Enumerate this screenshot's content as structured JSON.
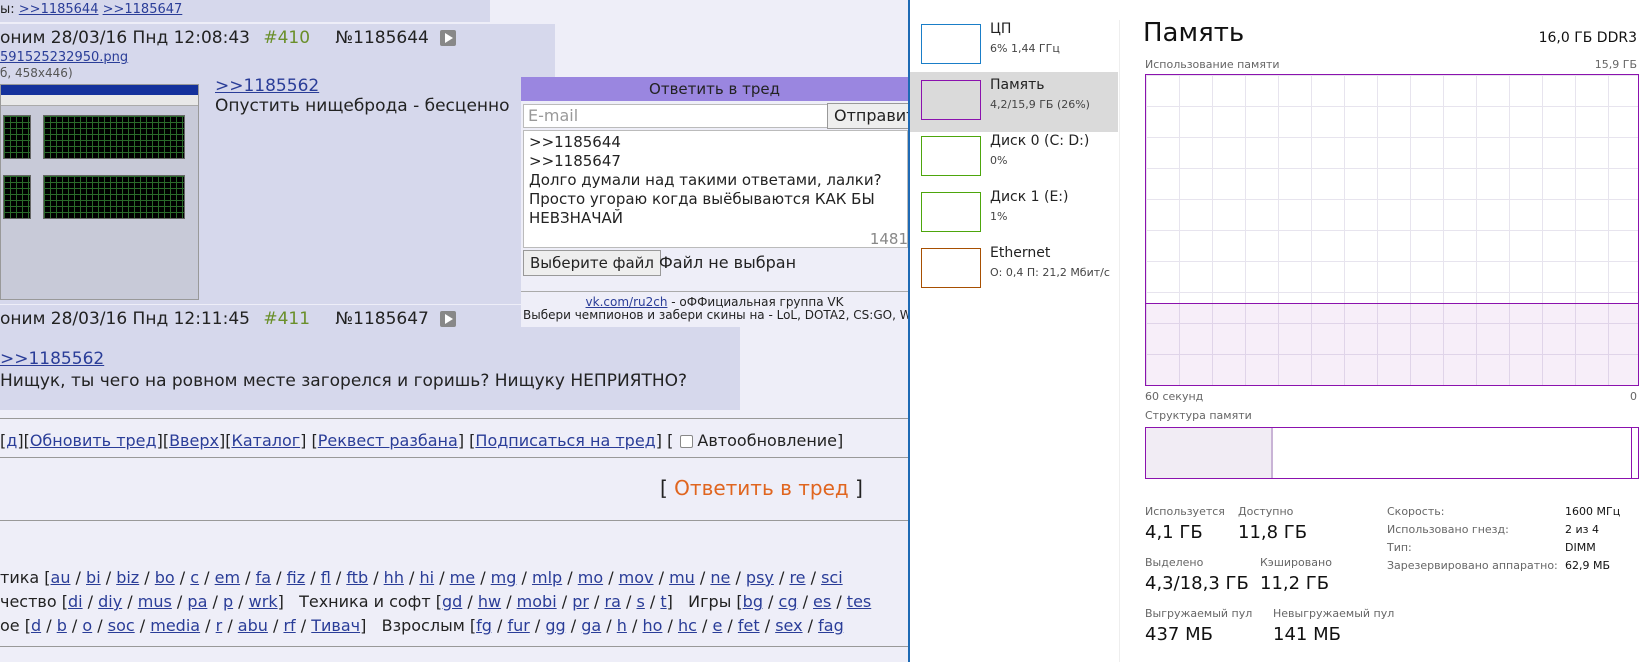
{
  "forum": {
    "topbar": {
      "prefix": "ы: ",
      "links": [
        ">>1185644",
        ">>1185647"
      ]
    },
    "post410": {
      "author_date": "оним 28/03/16 Пнд 12:08:43",
      "num": "#410",
      "id": "№1185644",
      "file": "591525232950.png",
      "file_meta": "б, 458x446)",
      "reply_link": ">>1185562",
      "text": "Опустить нищеброда - бесценно"
    },
    "post411": {
      "author_date": "оним 28/03/16 Пнд 12:11:45",
      "num": "#411",
      "id": "№1185647",
      "reply_link": ">>1185562",
      "text": "Нищук, ты чего на ровном месте загорелся и горишь? Нищуку НЕПРИЯТНО?"
    },
    "reply_form": {
      "title": "Ответить в тред",
      "email_placeholder": "E-mail",
      "send_label": "Отправит",
      "message_lines": [
        ">>1185644",
        ">>1185647",
        "Долго думали над такими ответами, лалки?",
        "Просто угораю когда выёбываются КАК БЫ",
        "НЕВЗНАЧАЙ"
      ],
      "char_count": "1481",
      "choose_file": "Выберите файл",
      "file_status": "Файл не выбран",
      "vk_link": "vk.com/ru2ch",
      "vk_text": " - оФФициальная группа VK",
      "promo": "Выбери чемпионов и забери скины на - LoL, DOTA2, CS:GO, W"
    },
    "nav": {
      "items": [
        "д",
        "Обновить тред",
        "Вверх",
        "Каталог",
        "Реквест разбана",
        "Подписаться на тред"
      ],
      "autoupdate_label": "Автообновление"
    },
    "reply_thread": "Ответить в тред",
    "boards": {
      "row1_label": "тика",
      "row1": [
        "au",
        "bi",
        "biz",
        "bo",
        "c",
        "em",
        "fa",
        "fiz",
        "fl",
        "ftb",
        "hh",
        "hi",
        "me",
        "mg",
        "mlp",
        "mo",
        "mov",
        "mu",
        "ne",
        "psy",
        "re",
        "sci"
      ],
      "row2a_label": "чество",
      "row2a": [
        "di",
        "diy",
        "mus",
        "pa",
        "p",
        "wrk"
      ],
      "row2b_label": "Техника и софт",
      "row2b": [
        "gd",
        "hw",
        "mobi",
        "pr",
        "ra",
        "s",
        "t"
      ],
      "row2c_label": "Игры",
      "row2c": [
        "bg",
        "cg",
        "es",
        "tes"
      ],
      "row3a_label": "ое",
      "row3a": [
        "d",
        "b",
        "o",
        "soc",
        "media",
        "r",
        "abu",
        "rf",
        "Тивач"
      ],
      "row3b_label": "Взрослым",
      "row3b": [
        "fg",
        "fur",
        "gg",
        "ga",
        "h",
        "ho",
        "hc",
        "e",
        "fet",
        "sex",
        "fag"
      ]
    }
  },
  "taskmgr": {
    "sidebar": [
      {
        "name": "ЦП",
        "sub": "6% 1,44 ГГц",
        "color": "#1a7ec8",
        "selected": false
      },
      {
        "name": "Память",
        "sub": "4,2/15,9 ГБ (26%)",
        "color": "#8b12ae",
        "selected": true
      },
      {
        "name": "Диск 0 (C: D:)",
        "sub": "0%",
        "color": "#4da60c",
        "selected": false
      },
      {
        "name": "Диск 1 (E:)",
        "sub": "1%",
        "color": "#4da60c",
        "selected": false
      },
      {
        "name": "Ethernet",
        "sub": "О: 0,4 П: 21,2 Мбит/с",
        "color": "#a74f01",
        "selected": false
      }
    ],
    "title": "Память",
    "total": "16,0 ГБ DDR3",
    "usage_label": "Использование памяти",
    "usage_max": "15,9 ГБ",
    "time_left": "60 секунд",
    "time_right": "0",
    "usage_fraction": 0.26,
    "structure_label": "Структура памяти",
    "stats": [
      {
        "label": "Используется",
        "value": "4,1 ГБ"
      },
      {
        "label": "Доступно",
        "value": "11,8 ГБ"
      },
      {
        "label": "Выделено",
        "value": "4,3/18,3 ГБ"
      },
      {
        "label": "Кэшировано",
        "value": "11,2 ГБ"
      },
      {
        "label": "Выгружаемый пул",
        "value": "437 МБ"
      },
      {
        "label": "Невыгружаемый пул",
        "value": "141 МБ"
      }
    ],
    "details": [
      {
        "label": "Скорость:",
        "value": "1600 МГц"
      },
      {
        "label": "Использовано гнезд:",
        "value": "2 из 4"
      },
      {
        "label": "Тип:",
        "value": "DIMM"
      },
      {
        "label": "Зарезервировано аппаратно:",
        "value": "62,9 МБ"
      }
    ]
  }
}
